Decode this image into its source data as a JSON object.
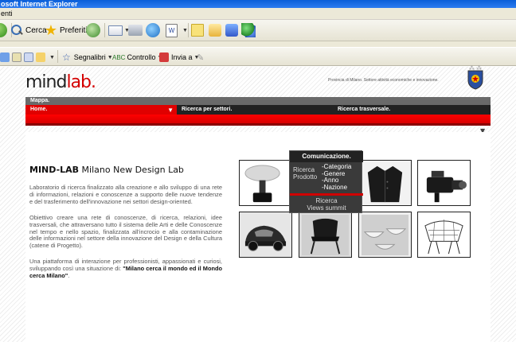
{
  "browser": {
    "title": "osoft Internet Explorer",
    "menu_fragment": "enti",
    "toolbar": {
      "search_label": "Cerca",
      "favorites_label": "Preferiti"
    },
    "google_bar": {
      "bookmarks_label": "Segnalibri",
      "check_label": "Controllo",
      "send_label": "Invia a"
    }
  },
  "site": {
    "logo": {
      "part1": "mind",
      "part2": "lab",
      "dot": "."
    },
    "province_text": "Provincia di Milano. Settore attività economiche e innovazione.",
    "nav": {
      "map_label": "Mappa.",
      "home_label": "Home.",
      "sector_label": "Ricerca per settori.",
      "transversal_label": "Ricerca trasversale."
    },
    "heading_bold": "MIND-LAB",
    "heading_rest": " Milano New Design Lab",
    "paragraphs": [
      "Laboratorio di ricerca finalizzato alla creazione e allo sviluppo di una rete di informazioni, relazioni e conoscenze a supporto delle nuove tendenze e del trasferimento dell'innovazione nei settori design-oriented.",
      "Obiettivo creare una rete di conoscenze, di ricerca, relazioni, idee trasversali, che attraversano tutto il sistema delle Arti e delle Conoscenze nel tempo e nello spazio, finalizzata all'incrocio e alla contaminazione delle informazioni nel settore della innovazione del Design e della Cultura (catene di Progetto)."
    ],
    "para3_start": "Una piattaforma di interazione per professionisti, appassionati e curiosi, sviluppando così una situazione di: ",
    "para3_bold": "\"Milano cerca il mondo ed il Mondo cerca Milano\"",
    "para3_end": ".",
    "overlay": {
      "title": "Comunicazione.",
      "left_line1": "Ricerca",
      "left_line2": "Prodotto",
      "items": [
        "-Categoria",
        "-Genere",
        "-Anno",
        "-Nazione"
      ],
      "bottom_line1": "Ricerca",
      "bottom_line2": "Views summit"
    }
  },
  "colors": {
    "brand_red": "#d40000",
    "nav_dark": "#222222",
    "nav_grey": "#6a6a6a"
  }
}
